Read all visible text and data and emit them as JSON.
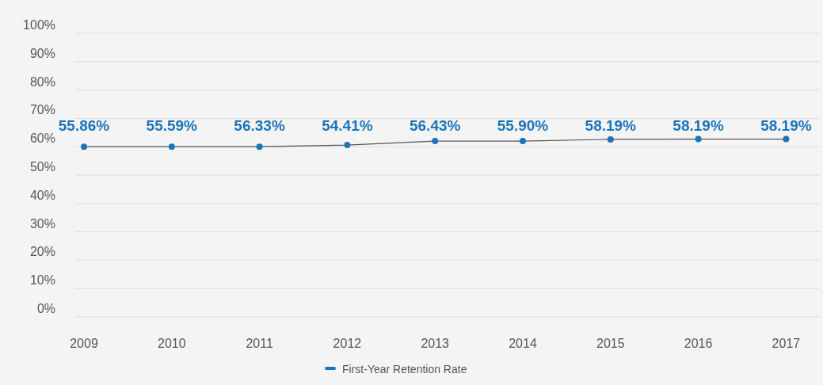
{
  "chart_data": {
    "type": "line",
    "grid": true,
    "categories": [
      "2009",
      "2010",
      "2011",
      "2012",
      "2013",
      "2014",
      "2015",
      "2016",
      "2017"
    ],
    "series": [
      {
        "name": "First-Year Retention Rate",
        "color": "#1a75bb",
        "marker": true,
        "values": [
          60.0,
          60.0,
          60.0,
          60.6,
          62.0,
          62.0,
          62.6,
          62.7,
          62.7
        ]
      }
    ],
    "ylim": [
      0,
      100
    ],
    "yticks": [
      {
        "value": 0,
        "label": "0%"
      },
      {
        "value": 10,
        "label": "10%"
      },
      {
        "value": 20,
        "label": "20%"
      },
      {
        "value": 30,
        "label": "30%"
      },
      {
        "value": 40,
        "label": "40%"
      },
      {
        "value": 50,
        "label": "50%"
      },
      {
        "value": 60,
        "label": "60%"
      },
      {
        "value": 70,
        "label": "70%"
      },
      {
        "value": 80,
        "label": "80%"
      },
      {
        "value": 90,
        "label": "90%"
      },
      {
        "value": 100,
        "label": "100%"
      }
    ],
    "value_labels": [
      "55.86%",
      "55.59%",
      "56.33%",
      "54.41%",
      "56.43%",
      "55.90%",
      "58.19%",
      "58.19%",
      "58.19%"
    ]
  }
}
